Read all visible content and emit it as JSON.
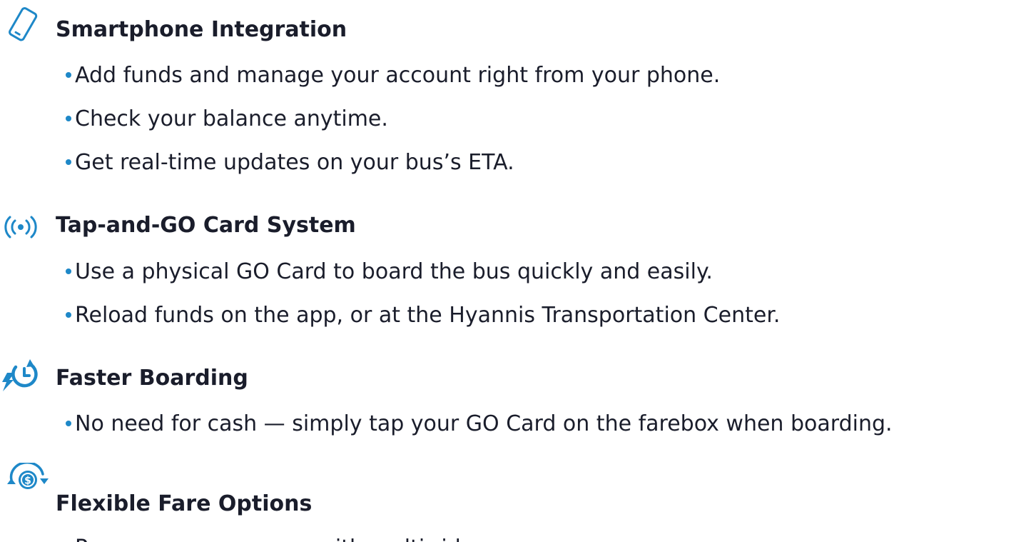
{
  "colors": {
    "accent": "#1e88c8",
    "text": "#1a1d2b",
    "background": "#ffffff"
  },
  "sections": [
    {
      "icon": "smartphone-icon",
      "title": "Smartphone Integration",
      "bullets": [
        "Add funds and manage your account right from your phone.",
        "Check your balance anytime.",
        "Get real-time updates on your bus’s ETA."
      ]
    },
    {
      "icon": "tap-signal-icon",
      "title": "Tap-and-GO Card System",
      "bullets": [
        "Use a physical GO Card to board the bus quickly and easily.",
        "Reload funds on the app, or at the Hyannis Transportation Center."
      ]
    },
    {
      "icon": "fast-clock-icon",
      "title": "Faster Boarding",
      "bullets": [
        "No need for cash — simply tap your GO Card on the farebox when boarding."
      ]
    },
    {
      "icon": "currency-exchange-icon",
      "title": "Flexible Fare Options",
      "bullets": [
        "Pay-as-you-go or save with multi-ride passes."
      ]
    }
  ]
}
